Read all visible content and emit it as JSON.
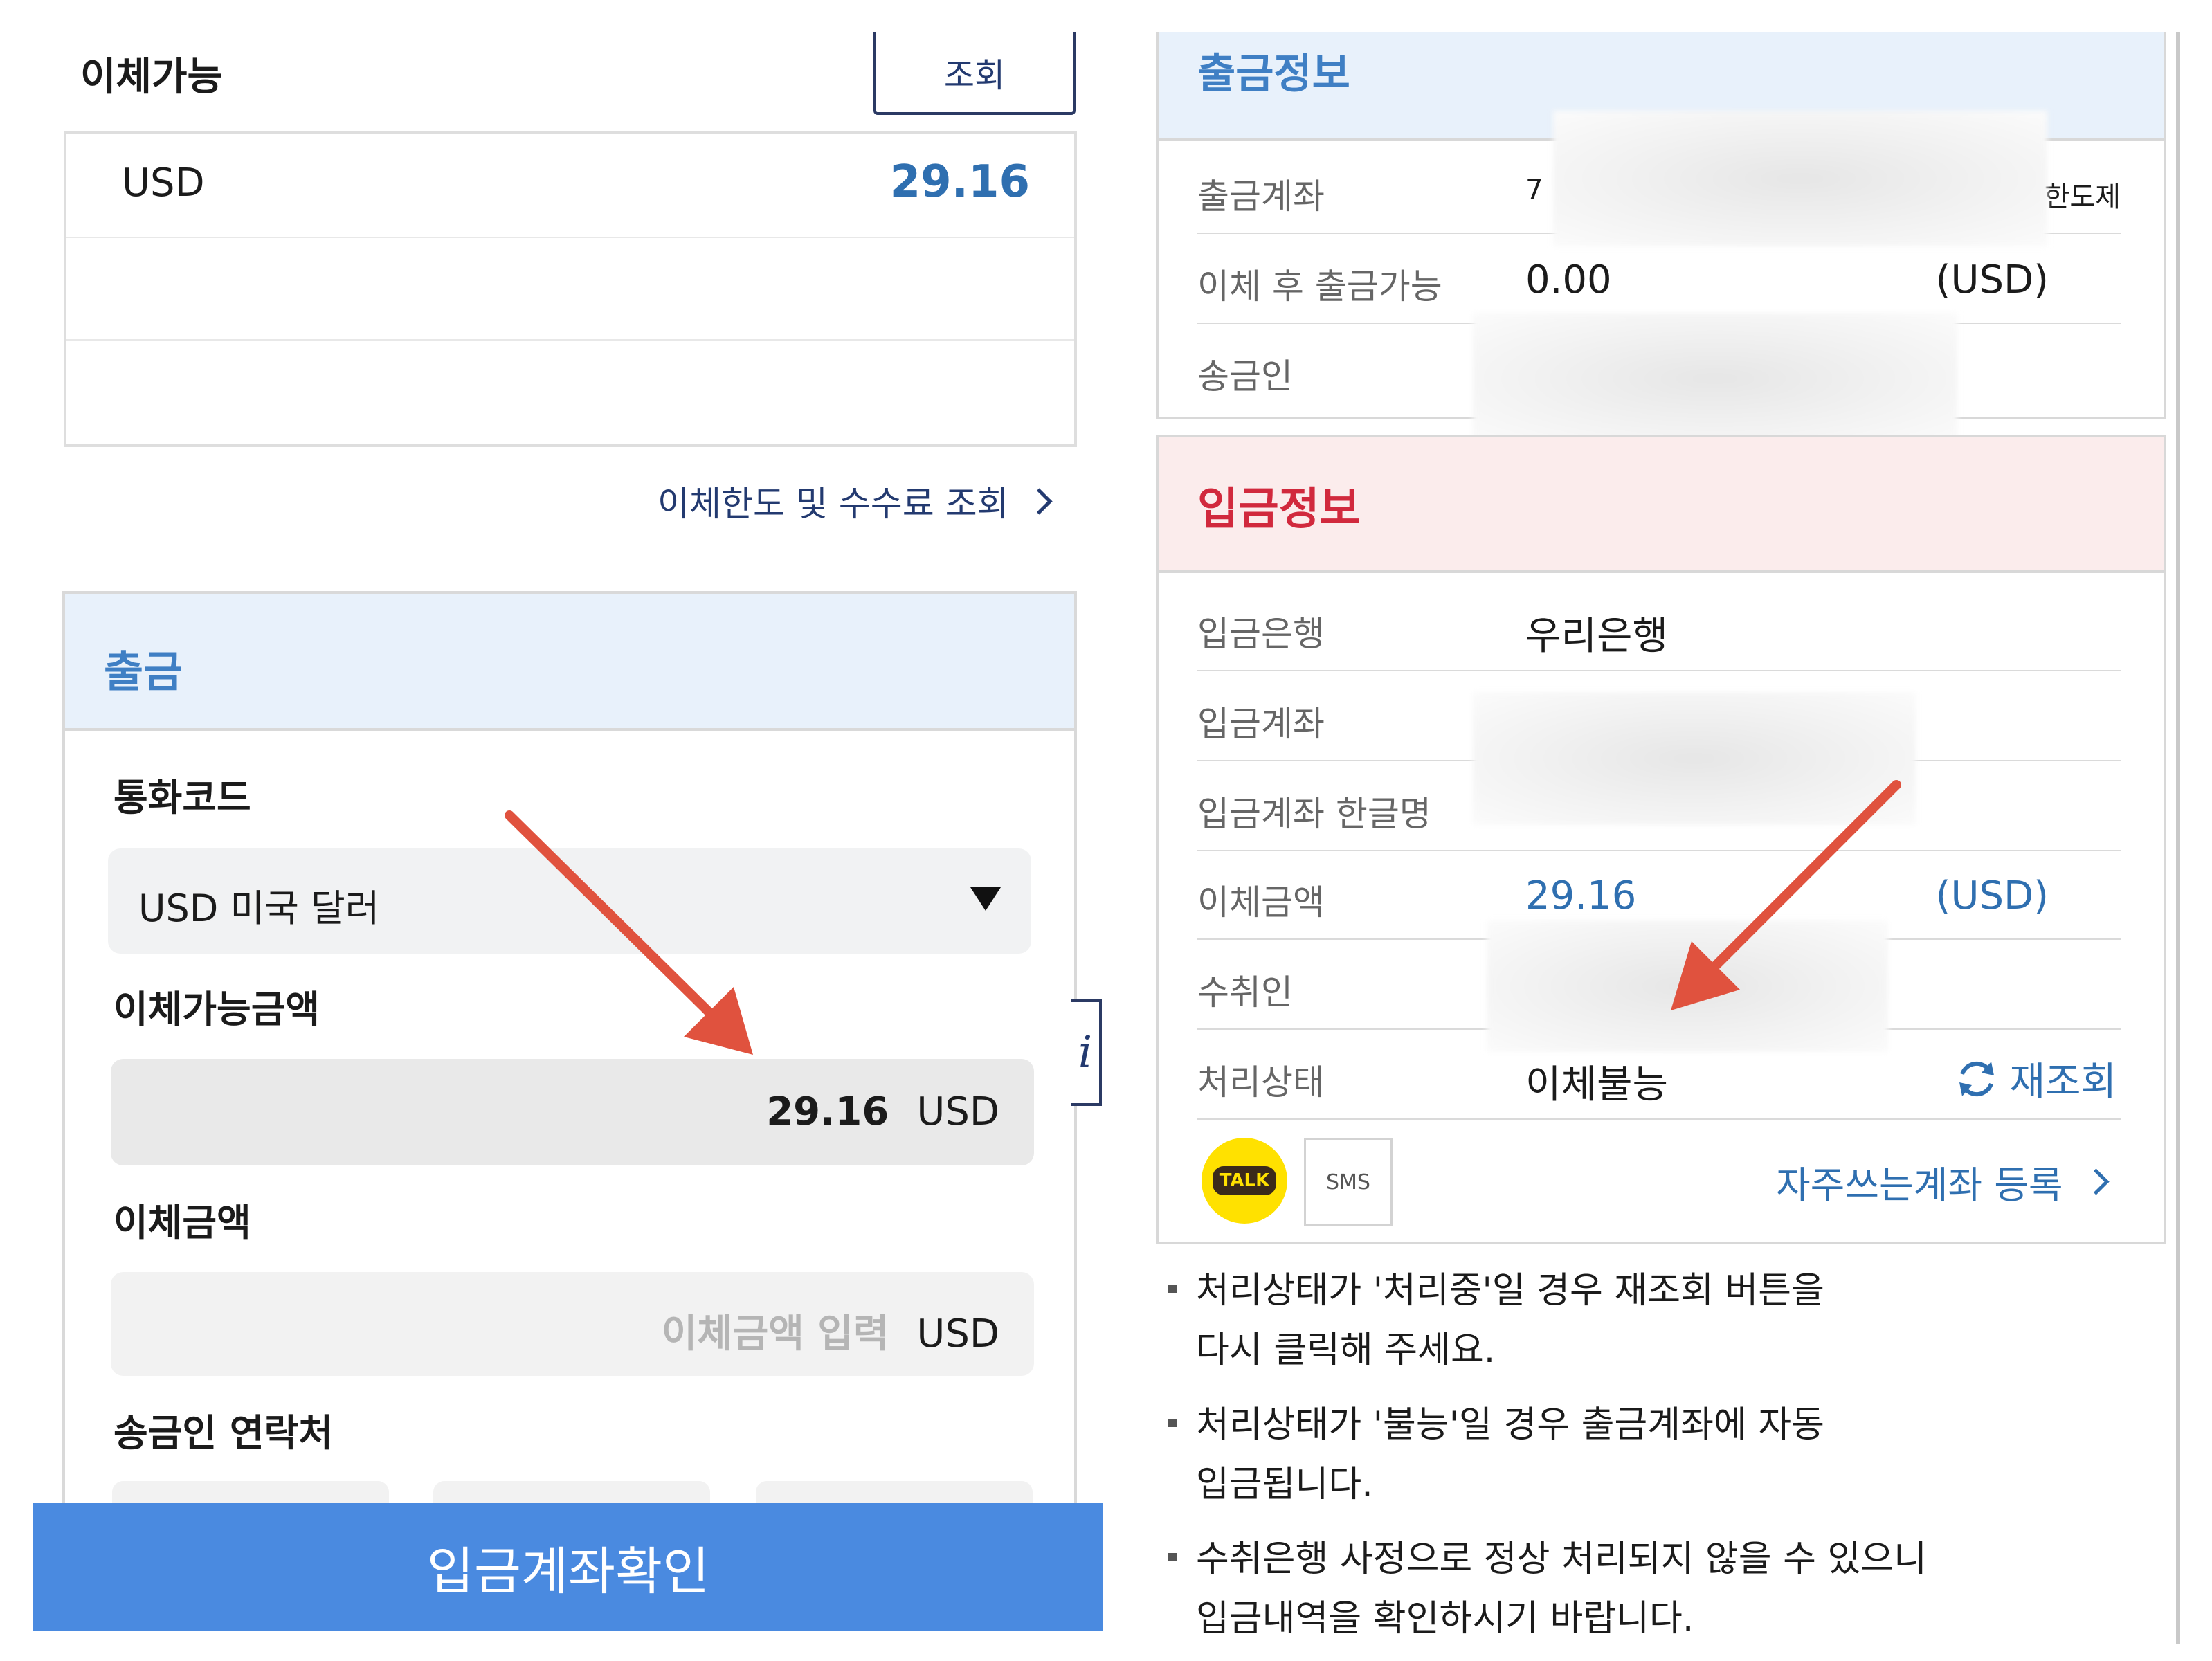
{
  "left": {
    "title": "이체가능",
    "query_button": "조회",
    "balance": {
      "currency": "USD",
      "amount": "29.16"
    },
    "limit_link": "이체한도 및 수수료 조회",
    "withdraw_section": {
      "title": "출금",
      "currency_label": "통화코드",
      "currency_value": "USD 미국 달러",
      "available_label": "이체가능금액",
      "available_value": "29.16",
      "available_unit": "USD",
      "amount_label": "이체금액",
      "amount_placeholder": "이체금액 입력",
      "amount_unit": "USD",
      "contact_label": "송금인 연락처"
    },
    "cta_button": "입금계좌확인",
    "info_tab": "i"
  },
  "right": {
    "withdraw_info": {
      "title": "출금정보",
      "rows": [
        {
          "label": "출금계좌",
          "value_prefix": "7",
          "value_suffix": "한도제"
        },
        {
          "label": "이체 후 출금가능",
          "value": "0.00",
          "unit": "(USD)"
        },
        {
          "label": "송금인"
        }
      ]
    },
    "deposit_info": {
      "title": "입금정보",
      "rows": [
        {
          "label": "입금은행",
          "value": "우리은행"
        },
        {
          "label": "입금계좌"
        },
        {
          "label": "입금계좌 한글명"
        },
        {
          "label": "이체금액",
          "value": "29.16",
          "unit": "(USD)"
        },
        {
          "label": "수취인"
        },
        {
          "label": "처리상태",
          "value": "이체불능",
          "action": "재조회"
        }
      ],
      "talk_label": "TALK",
      "sms_label": "SMS",
      "favorite_link": "자주쓰는계좌 등록"
    },
    "notes": [
      {
        "line1": "처리상태가 '처리중'일 경우 재조회 버튼을",
        "line2": "다시 클릭해 주세요."
      },
      {
        "line1": "처리상태가 '불능'일 경우 출금계좌에 자동",
        "line2": "입금됩니다."
      },
      {
        "line1": "수취은행 사정으로 정상 처리되지 않을 수 있으니",
        "line2": "입금내역을 확인하시기 바랍니다."
      }
    ]
  },
  "colors": {
    "accent_blue": "#2f6fb0",
    "header_red": "#d1293d",
    "cta_blue": "#4a8ae0",
    "annotation_arrow": "#e0523e"
  }
}
